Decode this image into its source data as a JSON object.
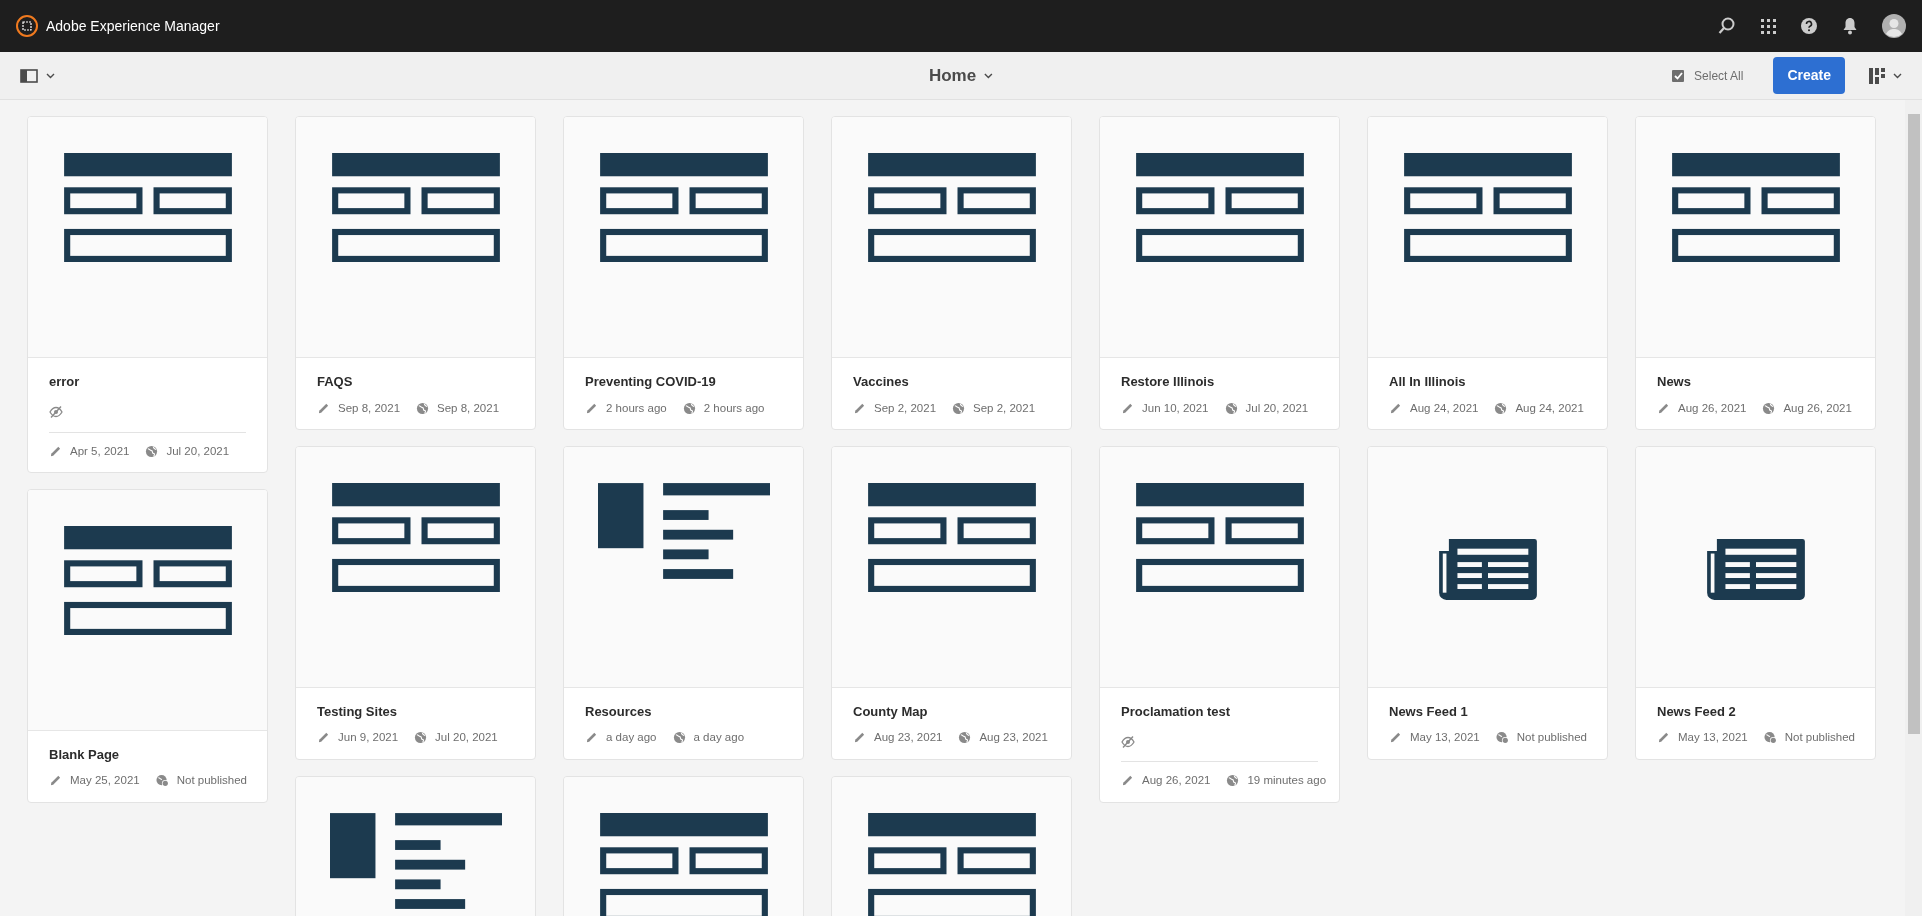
{
  "app": {
    "title": "Adobe Experience Manager"
  },
  "toolbar": {
    "location": "Home",
    "select_all": "Select All",
    "create": "Create"
  },
  "columns": [
    [
      {
        "kind": "layout",
        "title": "error",
        "hidden": true,
        "modified": "Apr 5, 2021",
        "published": "Jul 20, 2021",
        "is_published": true
      },
      {
        "kind": "layout",
        "title": "Blank Page",
        "hidden": false,
        "modified": "May 25, 2021",
        "published": "Not published",
        "is_published": false
      }
    ],
    [
      {
        "kind": "layout",
        "title": "FAQS",
        "hidden": false,
        "modified": "Sep 8, 2021",
        "published": "Sep 8, 2021",
        "is_published": true
      },
      {
        "kind": "layout",
        "title": "Testing Sites",
        "hidden": false,
        "modified": "Jun 9, 2021",
        "published": "Jul 20, 2021",
        "is_published": true
      },
      {
        "kind": "list"
      }
    ],
    [
      {
        "kind": "layout",
        "title": "Preventing COVID-19",
        "hidden": false,
        "modified": "2 hours ago",
        "published": "2 hours ago",
        "is_published": true
      },
      {
        "kind": "list",
        "title": "Resources",
        "hidden": false,
        "modified": "a day ago",
        "published": "a day ago",
        "is_published": true
      },
      {
        "kind": "layout"
      }
    ],
    [
      {
        "kind": "layout",
        "title": "Vaccines",
        "hidden": false,
        "modified": "Sep 2, 2021",
        "published": "Sep 2, 2021",
        "is_published": true
      },
      {
        "kind": "layout",
        "title": "County Map",
        "hidden": false,
        "modified": "Aug 23, 2021",
        "published": "Aug 23, 2021",
        "is_published": true
      },
      {
        "kind": "layout"
      }
    ],
    [
      {
        "kind": "layout",
        "title": "Restore Illinois",
        "hidden": false,
        "modified": "Jun 10, 2021",
        "published": "Jul 20, 2021",
        "is_published": true
      },
      {
        "kind": "layout",
        "title": "Proclamation test",
        "hidden": true,
        "modified": "Aug 26, 2021",
        "published": "19 minutes ago",
        "is_published": true
      }
    ],
    [
      {
        "kind": "layout",
        "title": "All In Illinois",
        "hidden": false,
        "modified": "Aug 24, 2021",
        "published": "Aug 24, 2021",
        "is_published": true
      },
      {
        "kind": "feed",
        "title": "News Feed 1",
        "hidden": false,
        "modified": "May 13, 2021",
        "published": "Not published",
        "is_published": false
      }
    ],
    [
      {
        "kind": "layout",
        "title": "News",
        "hidden": false,
        "modified": "Aug 26, 2021",
        "published": "Aug 26, 2021",
        "is_published": true
      },
      {
        "kind": "feed",
        "title": "News Feed 2",
        "hidden": false,
        "modified": "May 13, 2021",
        "published": "Not published",
        "is_published": false
      }
    ]
  ]
}
